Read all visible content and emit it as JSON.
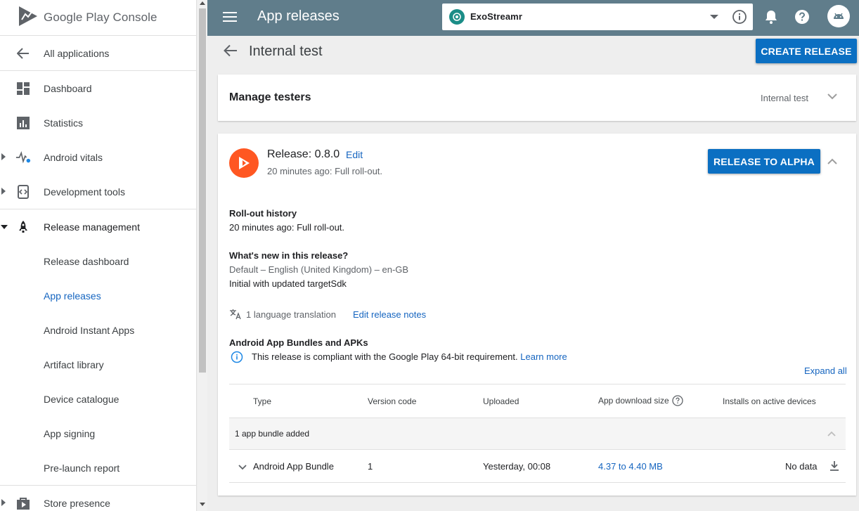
{
  "sidebar": {
    "brand": "Google Play Console",
    "items": [
      {
        "label": "All applications"
      },
      {
        "label": "Dashboard"
      },
      {
        "label": "Statistics"
      },
      {
        "label": "Android vitals"
      },
      {
        "label": "Development tools"
      },
      {
        "label": "Release management"
      },
      {
        "label": "Release dashboard"
      },
      {
        "label": "App releases"
      },
      {
        "label": "Android Instant Apps"
      },
      {
        "label": "Artifact library"
      },
      {
        "label": "Device catalogue"
      },
      {
        "label": "App signing"
      },
      {
        "label": "Pre-launch report"
      },
      {
        "label": "Store presence"
      }
    ]
  },
  "topbar": {
    "title": "App releases",
    "app_name": "ExoStreamr"
  },
  "page": {
    "heading": "Internal test",
    "create_release": "CREATE RELEASE"
  },
  "manage_testers": {
    "title": "Manage testers",
    "track": "Internal test"
  },
  "release": {
    "title": "Release: 0.8.0",
    "edit": "Edit",
    "subtitle": "20 minutes ago: Full roll-out.",
    "release_to": "RELEASE TO ALPHA",
    "rollout_heading": "Roll-out history",
    "rollout_text": "20 minutes ago: Full roll-out.",
    "whats_new_heading": "What's new in this release?",
    "whats_new_lang": "Default – English (United Kingdom) – en-GB",
    "whats_new_text": "Initial with updated targetSdk",
    "translations": "1 language translation",
    "edit_notes": "Edit release notes",
    "bundles_heading": "Android App Bundles and APKs",
    "compliance_text": "This release is compliant with the Google Play 64-bit requirement.",
    "learn_more": "Learn more",
    "expand_all": "Expand all"
  },
  "table": {
    "columns": [
      "Type",
      "Version code",
      "Uploaded",
      "App download size",
      "Installs on active devices"
    ],
    "group_label": "1 app bundle added",
    "row": {
      "type": "Android App Bundle",
      "version_code": "1",
      "uploaded": "Yesterday, 00:08",
      "download_size": "4.37 to 4.40 MB",
      "installs": "No data"
    }
  },
  "colors": {
    "topbar": "#607d8b",
    "primary_button": "#0b6fc2",
    "link": "#1565c0",
    "release_logo": "#ff5722",
    "app_logo": "#1b8d87"
  }
}
